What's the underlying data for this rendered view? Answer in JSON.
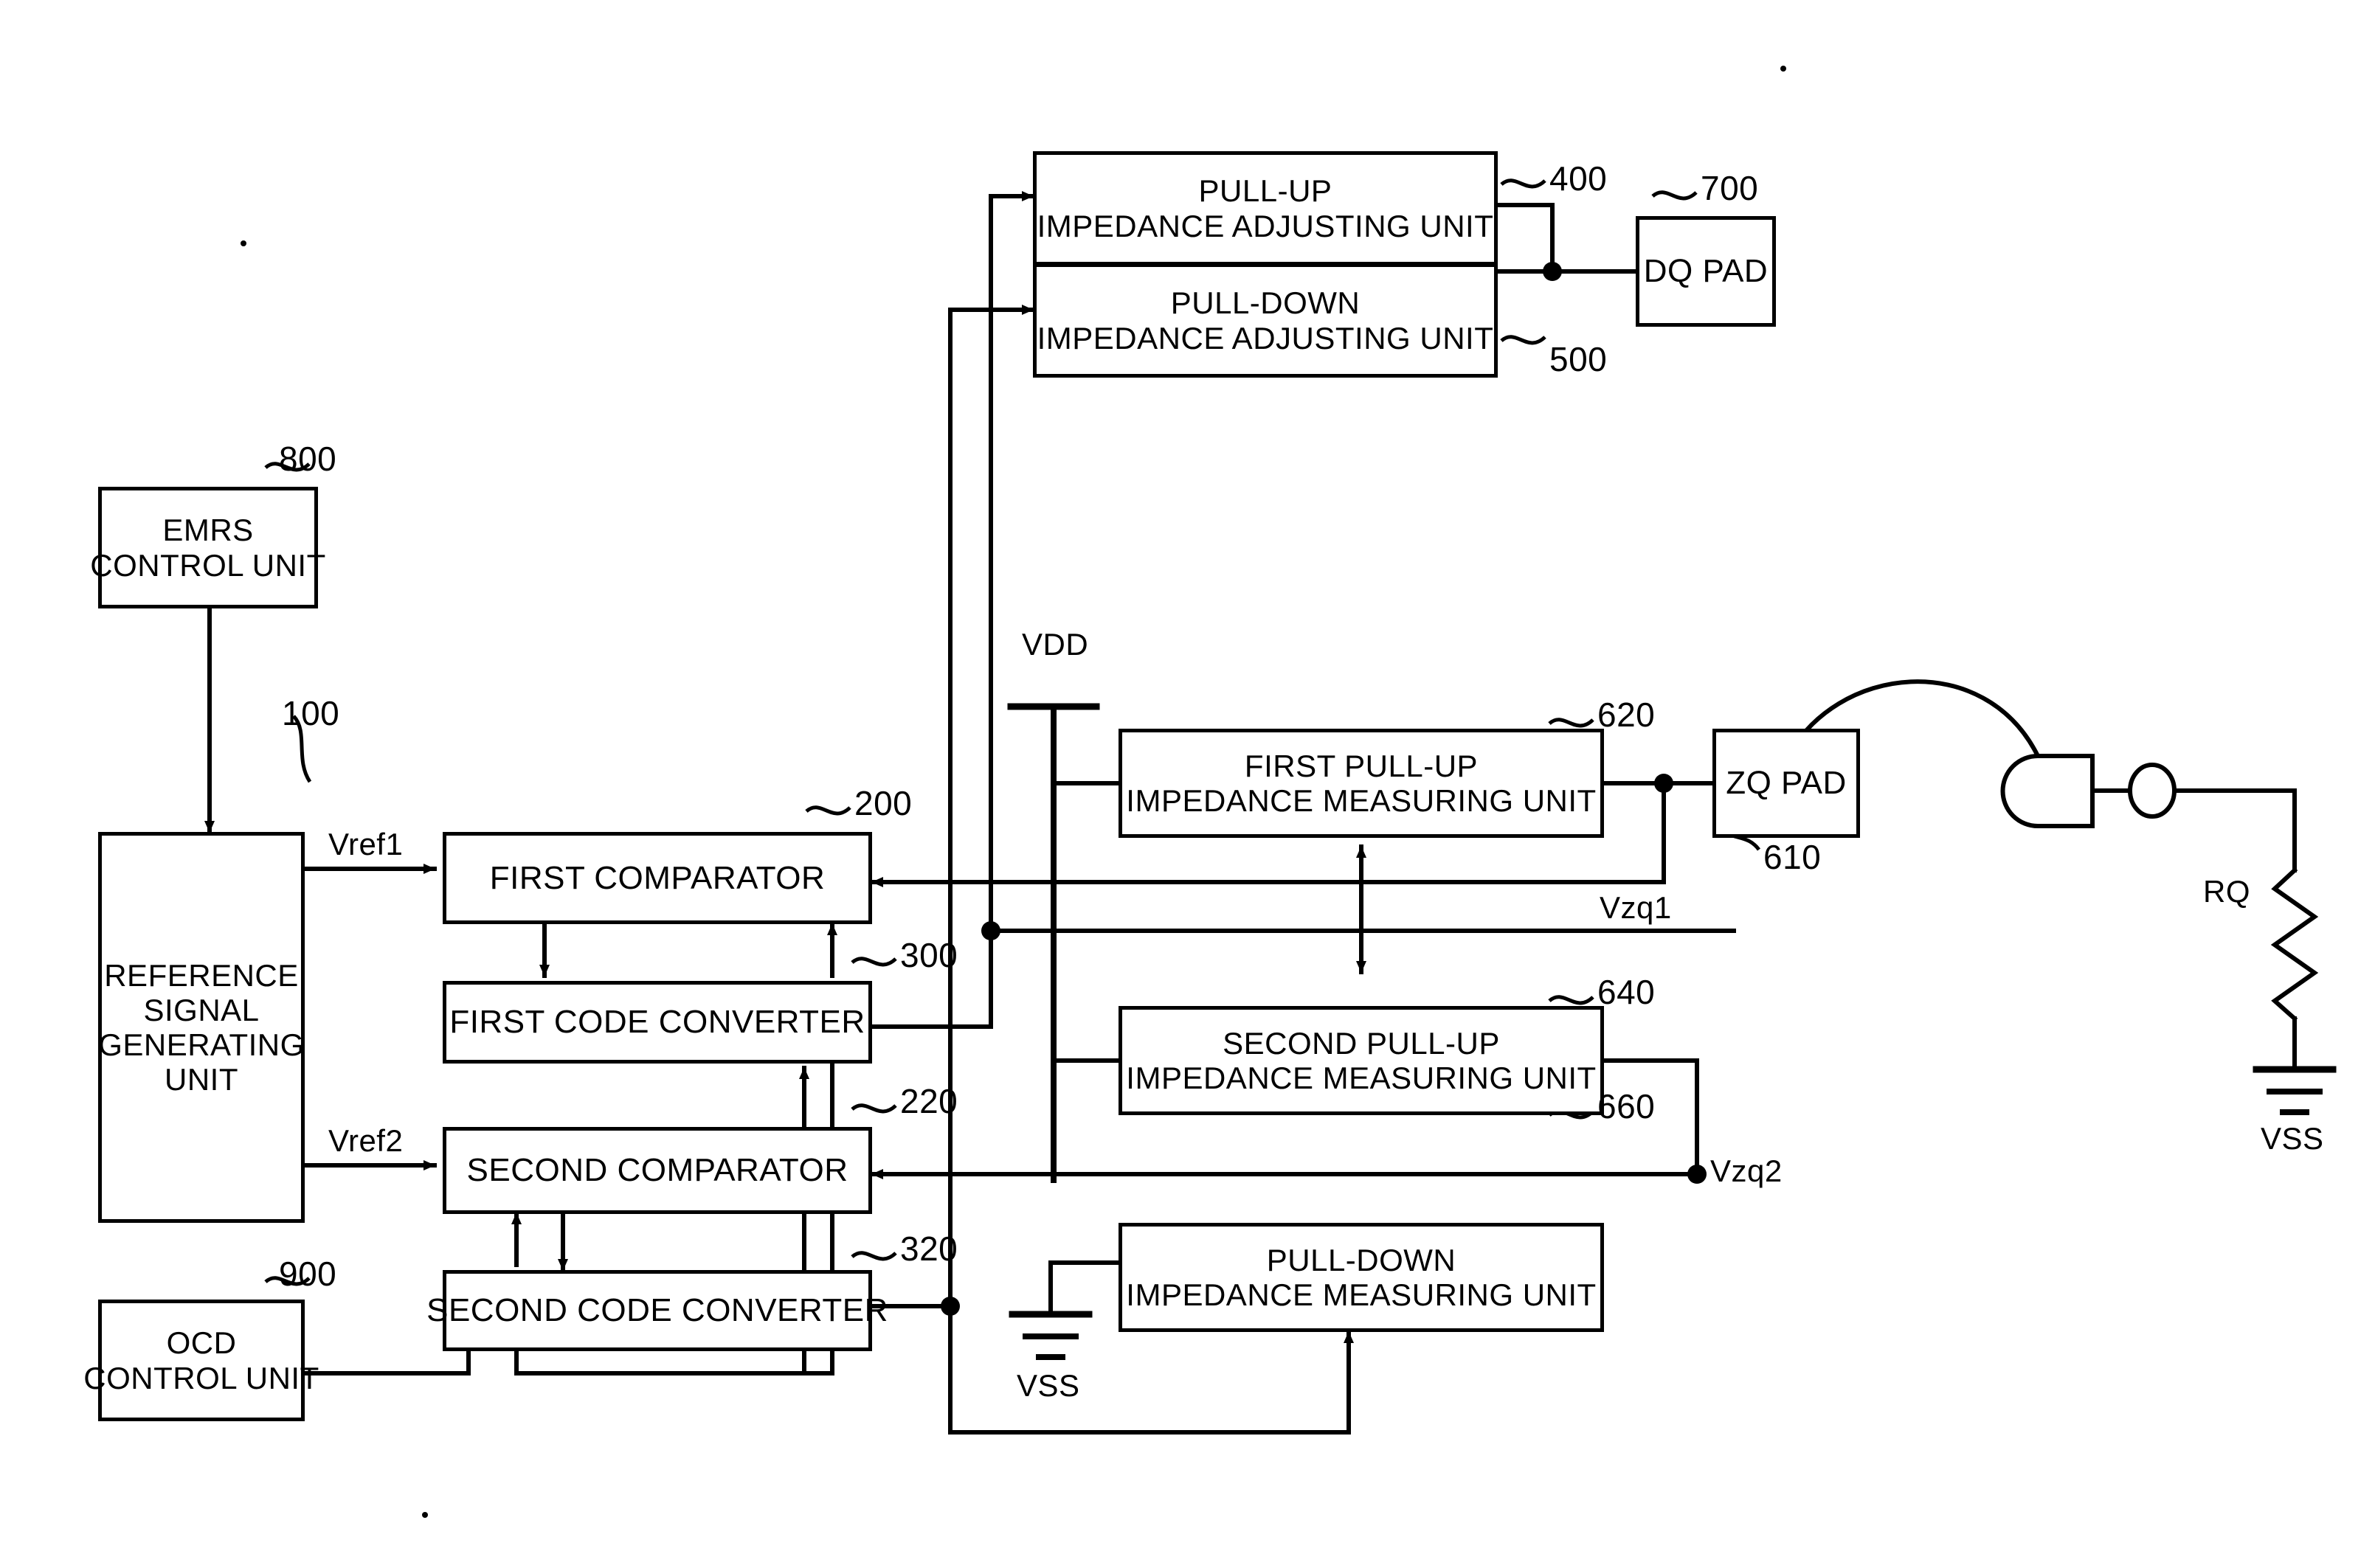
{
  "figure": {
    "type": "patent-block-diagram",
    "title": "On-die termination / impedance calibration block diagram"
  },
  "blocks": [
    {
      "id": "pull_up_adjust",
      "ref": "400",
      "lines": [
        "PULL-UP",
        "IMPEDANCE ADJUSTING UNIT"
      ]
    },
    {
      "id": "pull_down_adjust",
      "ref": "500",
      "lines": [
        "PULL-DOWN",
        "IMPEDANCE ADJUSTING UNIT"
      ]
    },
    {
      "id": "dq_pad",
      "ref": "700",
      "lines": [
        "DQ PAD"
      ]
    },
    {
      "id": "emrs_control",
      "ref": "800",
      "lines": [
        "EMRS",
        "CONTROL UNIT"
      ]
    },
    {
      "id": "reference_signal_generating",
      "ref": "100",
      "lines": [
        "REFERENCE",
        "SIGNAL",
        "GENERATING",
        "UNIT"
      ]
    },
    {
      "id": "first_comparator",
      "ref": "200",
      "lines": [
        "FIRST COMPARATOR"
      ]
    },
    {
      "id": "first_code_converter",
      "ref": "300",
      "lines": [
        "FIRST CODE CONVERTER"
      ]
    },
    {
      "id": "second_comparator",
      "ref": "220",
      "lines": [
        "SECOND COMPARATOR"
      ]
    },
    {
      "id": "second_code_converter",
      "ref": "320",
      "lines": [
        "SECOND CODE CONVERTER"
      ]
    },
    {
      "id": "ocd_control",
      "ref": "900",
      "lines": [
        "OCD",
        "CONTROL UNIT"
      ]
    },
    {
      "id": "first_pull_up_measuring",
      "ref": "620",
      "lines": [
        "FIRST PULL-UP",
        "IMPEDANCE MEASURING UNIT"
      ]
    },
    {
      "id": "second_pull_up_measuring",
      "ref": "640",
      "lines": [
        "SECOND PULL-UP",
        "IMPEDANCE MEASURING UNIT"
      ]
    },
    {
      "id": "pull_down_measuring",
      "ref": "660",
      "lines": [
        "PULL-DOWN",
        "IMPEDANCE MEASURING UNIT"
      ]
    },
    {
      "id": "zq_pad",
      "ref": "610",
      "lines": [
        "ZQ PAD"
      ]
    }
  ],
  "ref_numbers": {
    "pull_up_adjust": "400",
    "pull_down_adjust": "500",
    "dq_pad": "700",
    "emrs_control": "800",
    "reference_signal_generating": "100",
    "first_comparator": "200",
    "first_code_converter": "300",
    "second_comparator": "220",
    "second_code_converter": "320",
    "ocd_control": "900",
    "first_pull_up_measuring": "620",
    "second_pull_up_measuring": "640",
    "pull_down_measuring": "660",
    "zq_pad": "610"
  },
  "signals": {
    "vref1": "Vref1",
    "vref2": "Vref2",
    "vzq1": "Vzq1",
    "vzq2": "Vzq2",
    "vdd": "VDD",
    "vss_center": "VSS",
    "vss_right": "VSS",
    "rq": "RQ"
  },
  "colors": {
    "line": "#000000",
    "background": "#ffffff",
    "text": "#000000"
  }
}
